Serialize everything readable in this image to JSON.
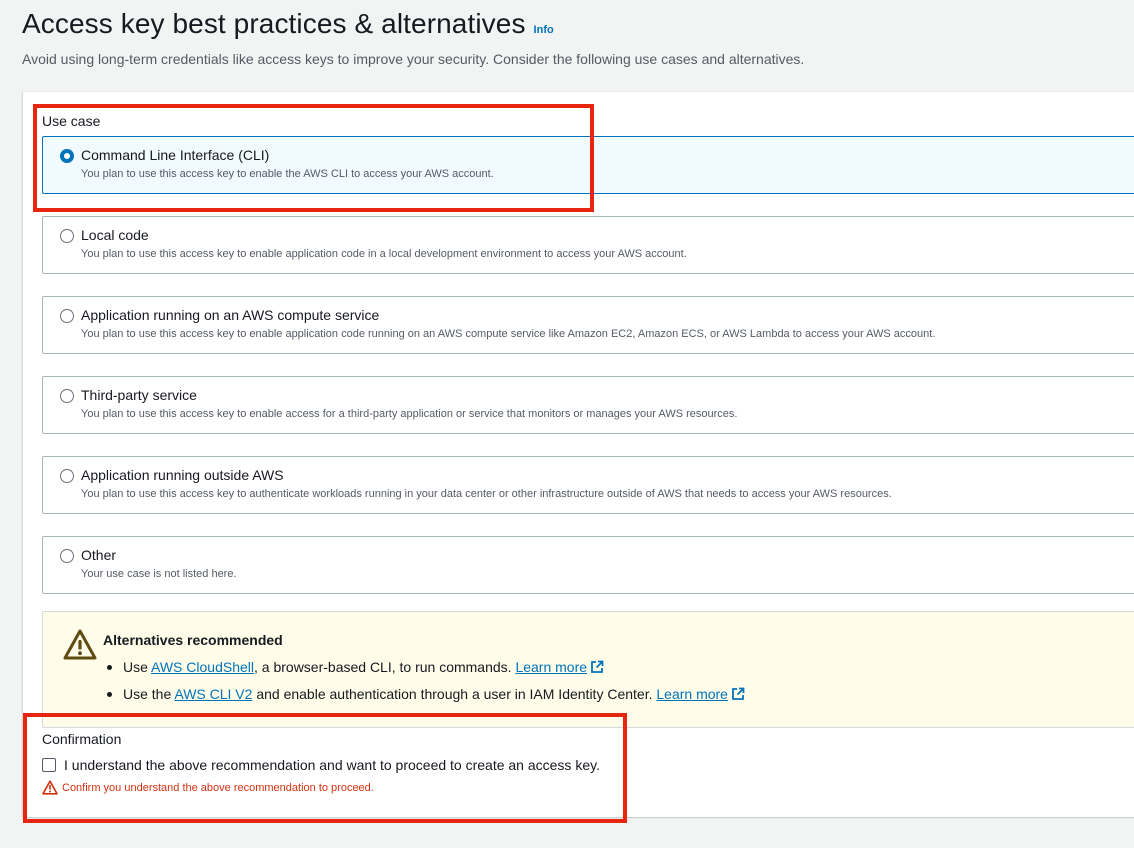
{
  "header": {
    "title": "Access key best practices & alternatives",
    "info_link": "Info",
    "description": "Avoid using long-term credentials like access keys to improve your security. Consider the following use cases and alternatives."
  },
  "use_case": {
    "label": "Use case",
    "options": [
      {
        "title": "Command Line Interface (CLI)",
        "description": "You plan to use this access key to enable the AWS CLI to access your AWS account.",
        "selected": true
      },
      {
        "title": "Local code",
        "description": "You plan to use this access key to enable application code in a local development environment to access your AWS account.",
        "selected": false
      },
      {
        "title": "Application running on an AWS compute service",
        "description": "You plan to use this access key to enable application code running on an AWS compute service like Amazon EC2, Amazon ECS, or AWS Lambda to access your AWS account.",
        "selected": false
      },
      {
        "title": "Third-party service",
        "description": "You plan to use this access key to enable access for a third-party application or service that monitors or manages your AWS resources.",
        "selected": false
      },
      {
        "title": "Application running outside AWS",
        "description": "You plan to use this access key to authenticate workloads running in your data center or other infrastructure outside of AWS that needs to access your AWS resources.",
        "selected": false
      },
      {
        "title": "Other",
        "description": "Your use case is not listed here.",
        "selected": false
      }
    ]
  },
  "alert": {
    "title": "Alternatives recommended",
    "items": [
      {
        "prefix": "Use ",
        "link": "AWS CloudShell",
        "middle": ", a browser-based CLI, to run commands. ",
        "learn_more": "Learn more"
      },
      {
        "prefix": "Use the ",
        "link": "AWS CLI V2",
        "middle": " and enable authentication through a user in IAM Identity Center. ",
        "learn_more": "Learn more"
      }
    ]
  },
  "confirmation": {
    "label": "Confirmation",
    "checkbox_label": "I understand the above recommendation and want to proceed to create an access key.",
    "checked": false,
    "error": "Confirm you understand the above recommendation to proceed."
  },
  "colors": {
    "accent": "#0073bb",
    "highlight": "#e8260f",
    "error": "#d13212",
    "warning_bg": "#fffce9"
  },
  "icons": {
    "alert": "warning-triangle-icon",
    "learn_more": "external-link-icon",
    "error": "error-triangle-icon"
  }
}
